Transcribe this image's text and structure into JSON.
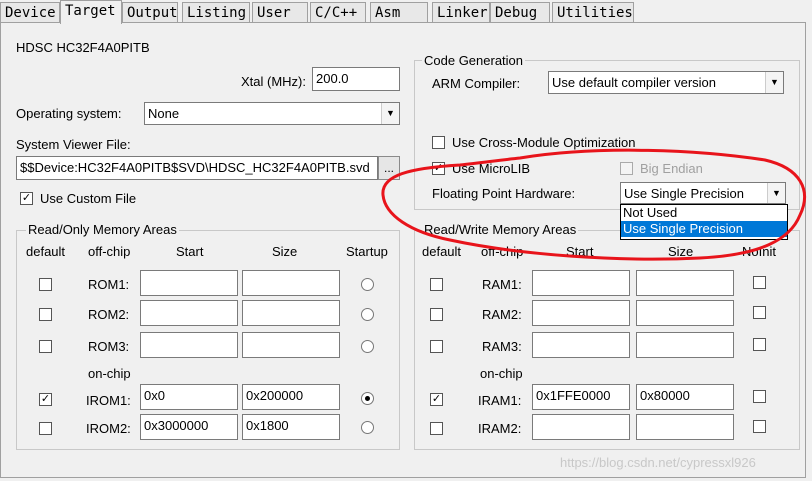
{
  "tabs": [
    "Device",
    "Target",
    "Output",
    "Listing",
    "User",
    "C/C++",
    "Asm",
    "Linker",
    "Debug",
    "Utilities"
  ],
  "active_tab": "Target",
  "device_name": "HDSC HC32F4A0PITB",
  "xtal": {
    "label": "Xtal (MHz):",
    "value": "200.0"
  },
  "os": {
    "label": "Operating system:",
    "value": "None"
  },
  "svf": {
    "label": "System Viewer File:",
    "value": "$$Device:HC32F4A0PITB$SVD\\HDSC_HC32F4A0PITB.svd",
    "browse_label": "..."
  },
  "use_custom_file": {
    "label": "Use Custom File",
    "checked": true
  },
  "code_gen": {
    "title": "Code Generation",
    "arm_compiler_label": "ARM Compiler:",
    "arm_compiler_value": "Use default compiler version",
    "cross_module": {
      "label": "Use Cross-Module Optimization",
      "checked": false
    },
    "microlib": {
      "label": "Use MicroLIB",
      "checked": true
    },
    "big_endian": {
      "label": "Big Endian",
      "checked": false
    },
    "fpu_label": "Floating Point Hardware:",
    "fpu_value": "Use Single Precision",
    "fpu_options": [
      "Not Used",
      "Use Single Precision"
    ]
  },
  "ro_memory": {
    "title": "Read/Only Memory Areas",
    "headers": {
      "default": "default",
      "offchip": "off-chip",
      "start": "Start",
      "size": "Size",
      "startup": "Startup"
    },
    "onchip_label": "on-chip",
    "rows": [
      {
        "name": "ROM1:",
        "start": "",
        "size": "",
        "default": false,
        "startup": false
      },
      {
        "name": "ROM2:",
        "start": "",
        "size": "",
        "default": false,
        "startup": false
      },
      {
        "name": "ROM3:",
        "start": "",
        "size": "",
        "default": false,
        "startup": false
      },
      {
        "name": "IROM1:",
        "start": "0x0",
        "size": "0x200000",
        "default": true,
        "startup": true
      },
      {
        "name": "IROM2:",
        "start": "0x3000000",
        "size": "0x1800",
        "default": false,
        "startup": false
      }
    ]
  },
  "rw_memory": {
    "title": "Read/Write Memory Areas",
    "headers": {
      "default": "default",
      "offchip": "off-chip",
      "start": "Start",
      "size": "Size",
      "noinit": "NoInit"
    },
    "onchip_label": "on-chip",
    "rows": [
      {
        "name": "RAM1:",
        "start": "",
        "size": "",
        "default": false,
        "noinit": false
      },
      {
        "name": "RAM2:",
        "start": "",
        "size": "",
        "default": false,
        "noinit": false
      },
      {
        "name": "RAM3:",
        "start": "",
        "size": "",
        "default": false,
        "noinit": false
      },
      {
        "name": "IRAM1:",
        "start": "0x1FFE0000",
        "size": "0x80000",
        "default": true,
        "noinit": false
      },
      {
        "name": "IRAM2:",
        "start": "",
        "size": "",
        "default": false,
        "noinit": false
      }
    ]
  },
  "watermark": "https://blog.csdn.net/cypressxl926",
  "colors": {
    "annotation": "#e8141b",
    "highlight": "#0078d7"
  }
}
